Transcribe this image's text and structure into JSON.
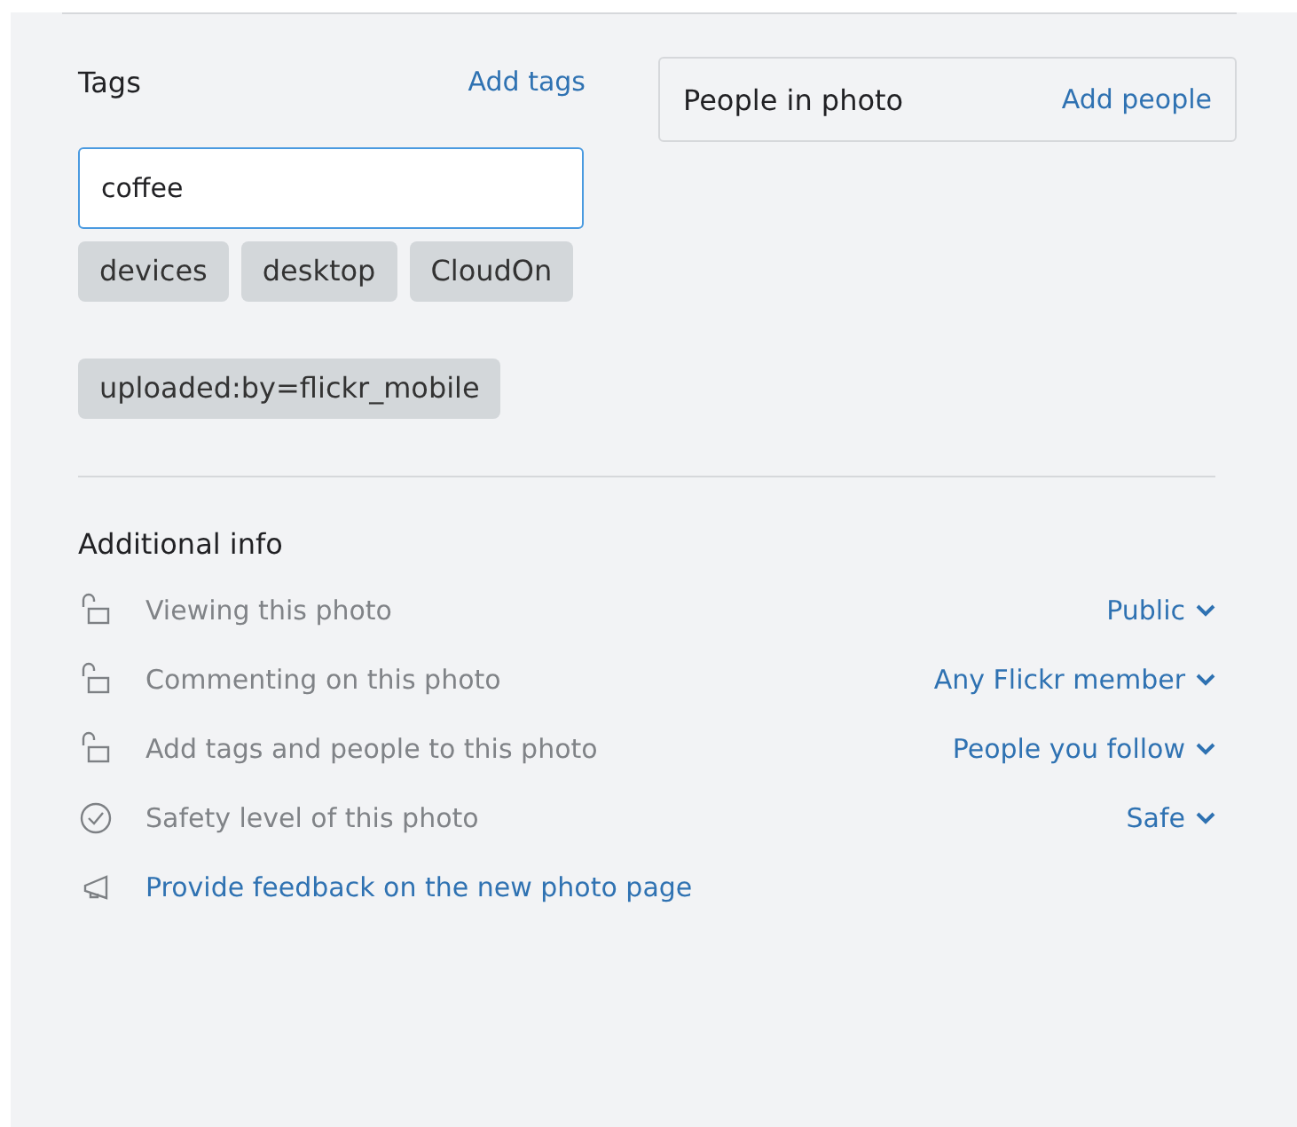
{
  "tags": {
    "title": "Tags",
    "add_link": "Add tags",
    "input": {
      "value": "coffee"
    },
    "items": [
      {
        "label": "devices"
      },
      {
        "label": "desktop"
      },
      {
        "label": "CloudOn"
      }
    ],
    "machine_tags": [
      {
        "label": "uploaded:by=flickr_mobile"
      }
    ]
  },
  "people": {
    "title": "People in photo",
    "add_link": "Add people"
  },
  "additional_info": {
    "title": "Additional info",
    "rows": [
      {
        "kind": "lock",
        "label": "Viewing this photo",
        "value": "Public"
      },
      {
        "kind": "lock",
        "label": "Commenting on this photo",
        "value": "Any Flickr member"
      },
      {
        "kind": "lock",
        "label": "Add tags and people to this photo",
        "value": "People you follow"
      },
      {
        "kind": "check",
        "label": "Safety level of this photo",
        "value": "Safe"
      },
      {
        "kind": "feedback",
        "label": "Provide feedback on the new photo page"
      }
    ]
  }
}
